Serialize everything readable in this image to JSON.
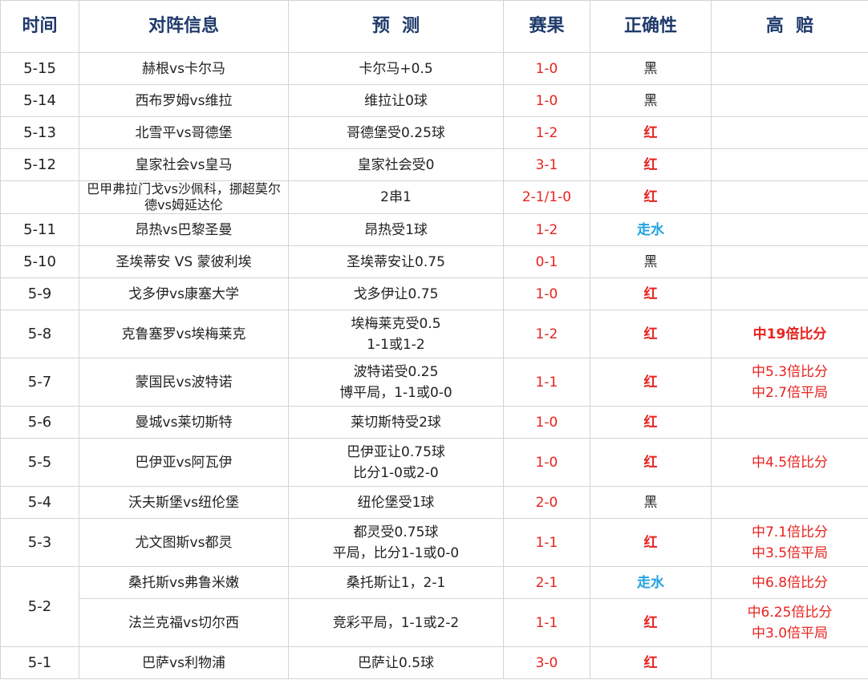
{
  "headers": [
    "时间",
    "对阵信息",
    "预  测",
    "赛果",
    "正确性",
    "高  赔"
  ],
  "rows": [
    {
      "date": "5-15",
      "match": "赫根vs卡尔马",
      "prediction": [
        "卡尔马+0.5"
      ],
      "result": "1-0",
      "correct": "黑",
      "correct_color": "black",
      "high": []
    },
    {
      "date": "5-14",
      "match": "西布罗姆vs维拉",
      "prediction": [
        "维拉让0球"
      ],
      "result": "1-0",
      "correct": "黑",
      "correct_color": "black",
      "high": []
    },
    {
      "date": "5-13",
      "match": "北雪平vs哥德堡",
      "prediction": [
        "哥德堡受0.25球"
      ],
      "result": "1-2",
      "correct": "红",
      "correct_color": "red",
      "high": []
    },
    {
      "date": "5-12",
      "match": "皇家社会vs皇马",
      "prediction": [
        "皇家社会受0"
      ],
      "result": "3-1",
      "correct": "红",
      "correct_color": "red",
      "high": []
    },
    {
      "date": "",
      "match": "巴甲弗拉门戈vs沙佩科，挪超莫尔德vs姆延达伦",
      "prediction": [
        "2串1"
      ],
      "result": "2-1/1-0",
      "correct": "红",
      "correct_color": "red",
      "high": []
    },
    {
      "date": "5-11",
      "match": "昂热vs巴黎圣曼",
      "prediction": [
        "昂热受1球"
      ],
      "result": "1-2",
      "correct": "走水",
      "correct_color": "blue",
      "high": []
    },
    {
      "date": "5-10",
      "match": "圣埃蒂安 VS 蒙彼利埃",
      "prediction": [
        "圣埃蒂安让0.75"
      ],
      "result": "0-1",
      "correct": "黑",
      "correct_color": "black",
      "high": []
    },
    {
      "date": "5-9",
      "match": "戈多伊vs康塞大学",
      "prediction": [
        "戈多伊让0.75"
      ],
      "result": "1-0",
      "correct": "红",
      "correct_color": "red",
      "high": []
    },
    {
      "date": "5-8",
      "match": "克鲁塞罗vs埃梅莱克",
      "prediction": [
        "埃梅莱克受0.5",
        "1-1或1-2"
      ],
      "result": "1-2",
      "correct": "红",
      "correct_color": "red",
      "high": [
        "中19倍比分"
      ],
      "high_bold": true
    },
    {
      "date": "5-7",
      "match": "蒙国民vs波特诺",
      "prediction": [
        "波特诺受0.25",
        "博平局，1-1或0-0"
      ],
      "result": "1-1",
      "correct": "红",
      "correct_color": "red",
      "high": [
        "中5.3倍比分",
        "中2.7倍平局"
      ]
    },
    {
      "date": "5-6",
      "match": "曼城vs莱切斯特",
      "prediction": [
        "莱切斯特受2球"
      ],
      "result": "1-0",
      "correct": "红",
      "correct_color": "red",
      "high": []
    },
    {
      "date": "5-5",
      "match": "巴伊亚vs阿瓦伊",
      "prediction": [
        "巴伊亚让0.75球",
        "比分1-0或2-0"
      ],
      "result": "1-0",
      "correct": "红",
      "correct_color": "red",
      "high": [
        "中4.5倍比分"
      ]
    },
    {
      "date": "5-4",
      "match": "沃夫斯堡vs纽伦堡",
      "prediction": [
        "纽伦堡受1球"
      ],
      "result": "2-0",
      "correct": "黑",
      "correct_color": "black",
      "high": []
    },
    {
      "date": "5-3",
      "match": "尤文图斯vs都灵",
      "prediction": [
        "都灵受0.75球",
        "平局，比分1-1或0-0"
      ],
      "result": "1-1",
      "correct": "红",
      "correct_color": "red",
      "high": [
        "中7.1倍比分",
        "中3.5倍平局"
      ]
    },
    {
      "date": "5-2",
      "match": "桑托斯vs弗鲁米嫩",
      "prediction": [
        "桑托斯让1，2-1"
      ],
      "result": "2-1",
      "correct": "走水",
      "correct_color": "blue",
      "high": [
        "中6.8倍比分"
      ]
    },
    {
      "date": "",
      "match": "法兰克福vs切尔西",
      "prediction": [
        "竞彩平局，1-1或2-2"
      ],
      "result": "1-1",
      "correct": "红",
      "correct_color": "red",
      "high": [
        "中6.25倍比分",
        "中3.0倍平局"
      ]
    },
    {
      "date": "5-1",
      "match": "巴萨vs利物浦",
      "prediction": [
        "巴萨让0.5球"
      ],
      "result": "3-0",
      "correct": "红",
      "correct_color": "red",
      "high": []
    }
  ]
}
